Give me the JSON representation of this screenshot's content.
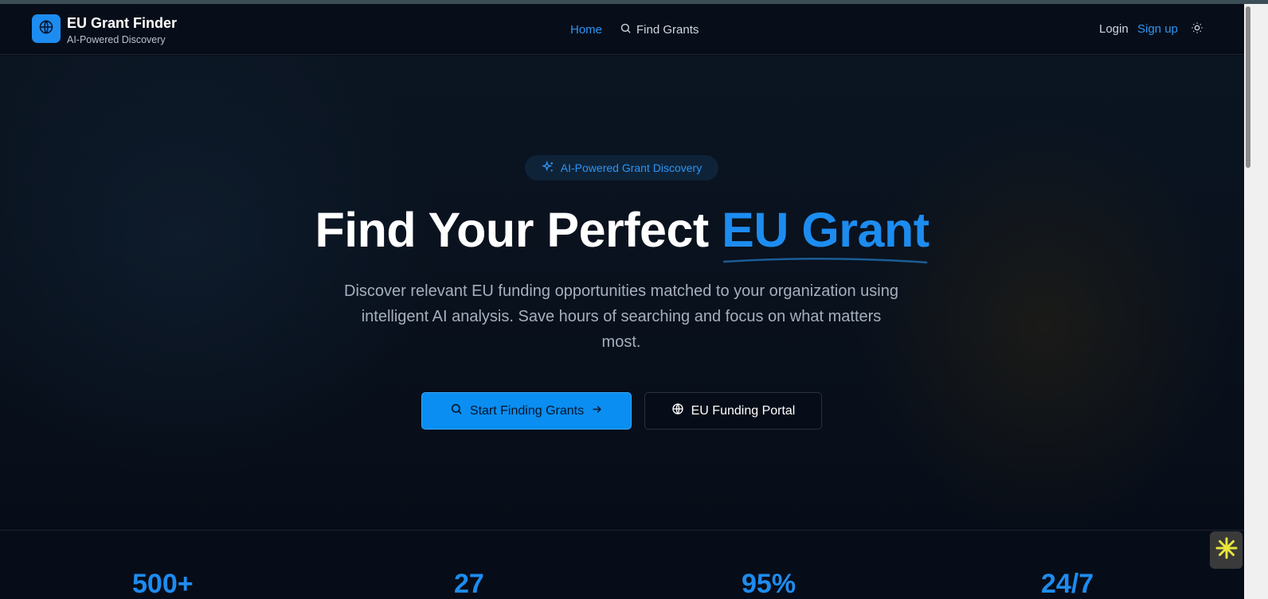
{
  "header": {
    "brand_title": "EU Grant Finder",
    "brand_subtitle": "AI-Powered Discovery",
    "nav": {
      "home": "Home",
      "find_grants": "Find Grants"
    },
    "auth": {
      "login": "Login",
      "signup": "Sign up"
    }
  },
  "hero": {
    "badge": "AI-Powered Grant Discovery",
    "headline_plain": "Find Your Perfect",
    "headline_accent": "EU Grant",
    "description": "Discover relevant EU funding opportunities matched to your organization using intelligent AI analysis. Save hours of searching and focus on what matters most.",
    "primary_button": "Start Finding Grants",
    "secondary_button": "EU Funding Portal"
  },
  "stats": [
    {
      "value": "500+"
    },
    {
      "value": "27"
    },
    {
      "value": "95%"
    },
    {
      "value": "24/7"
    }
  ],
  "colors": {
    "accent": "#1d8cf0",
    "background": "#070d18",
    "text_muted": "#a5afbd"
  },
  "icons": [
    "globe-icon",
    "search-icon",
    "sparkles-icon",
    "sun-icon",
    "arrow-right-icon",
    "asterisk-widget-icon"
  ]
}
